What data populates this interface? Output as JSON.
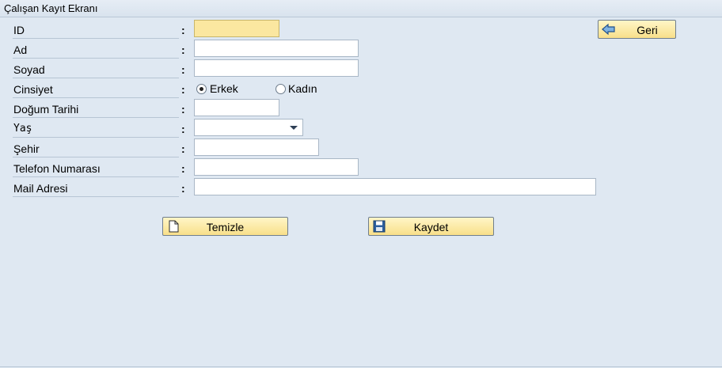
{
  "window": {
    "title": "Çalışan Kayıt Ekranı"
  },
  "form": {
    "colon": ":",
    "labels": {
      "id": "ID",
      "ad": "Ad",
      "soyad": "Soyad",
      "cinsiyet": "Cinsiyet",
      "dogum_tarihi": "Doğum Tarihi",
      "yas": "Yaş",
      "sehir": "Şehir",
      "telefon": "Telefon Numarası",
      "mail": "Mail Adresi"
    },
    "values": {
      "id": "",
      "ad": "",
      "soyad": "",
      "dogum_tarihi": "",
      "yas": "",
      "sehir": "",
      "telefon": "",
      "mail": ""
    },
    "gender": {
      "options": [
        "Erkek",
        "Kadın"
      ],
      "selected": "Erkek"
    }
  },
  "buttons": {
    "geri": "Geri",
    "temizle": "Temizle",
    "kaydet": "Kaydet"
  },
  "icons": {
    "geri": "back-arrow-icon",
    "temizle": "blank-document-icon",
    "kaydet": "floppy-disk-icon",
    "yas_dropdown": "chevron-down-icon"
  },
  "colors": {
    "background": "#dfe8f2",
    "button_fill": "#f8df8a",
    "focused_field": "#fbe7a0",
    "focus_corners": "#c62828"
  }
}
